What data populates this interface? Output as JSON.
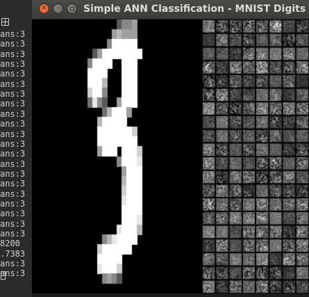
{
  "terminal": {
    "lines": [
      "ans:3",
      "ans:3",
      "ans:3",
      "ans:3",
      "ans:3",
      "ans:3",
      "ans:3",
      "ans:3",
      "ans:3",
      "ans:3",
      "ans:3",
      "ans:3",
      "ans:3",
      "ans:3",
      "ans:3",
      "ans:3",
      "ans:3",
      "ans:3",
      "ans:3",
      "ans:3",
      "ans:3",
      "8200",
      ".7383",
      "ans:3",
      "ans:3"
    ]
  },
  "window": {
    "title": "Simple ANN Classification - MNIST Digits",
    "close_glyph": "✕",
    "minimize_glyph": "–"
  },
  "digit_image": {
    "label": "3",
    "grid_size": 28,
    "pixels": {
      "r1": "...........2445.............",
      "r2": "..........56555.............",
      "r3": ".........499999.............",
      "r4": "......2599999999............",
      "r5": ".....49999..999.............",
      "r6": ".....9999...999.............",
      "r7": ".....9996...999.............",
      "r8": ".....7994...999.............",
      "r9": ".....3842..5999.............",
      "r10": "........369995..............",
      "r11": ".......699999...............",
      "r12": ".......99999997.............",
      "r13": ".......99999999.............",
      "r14": ".......5999.9997............",
      "r15": "...........49998............",
      "r16": "............5999............",
      "r17": "............6999............",
      "r18": "............7999............",
      "r19": "............8999............",
      "r20": "............9999............",
      "r21": "............9998............",
      "r22": "...........89996............",
      "r23": "........4689999.............",
      "r24": ".......7999999..............",
      "r25": ".......99999................",
      "r26": ".......89997................",
      "r27": "........4542................",
      "r28": "............................"
    }
  },
  "feature_grid": {
    "rows": 20,
    "cols": 8
  }
}
